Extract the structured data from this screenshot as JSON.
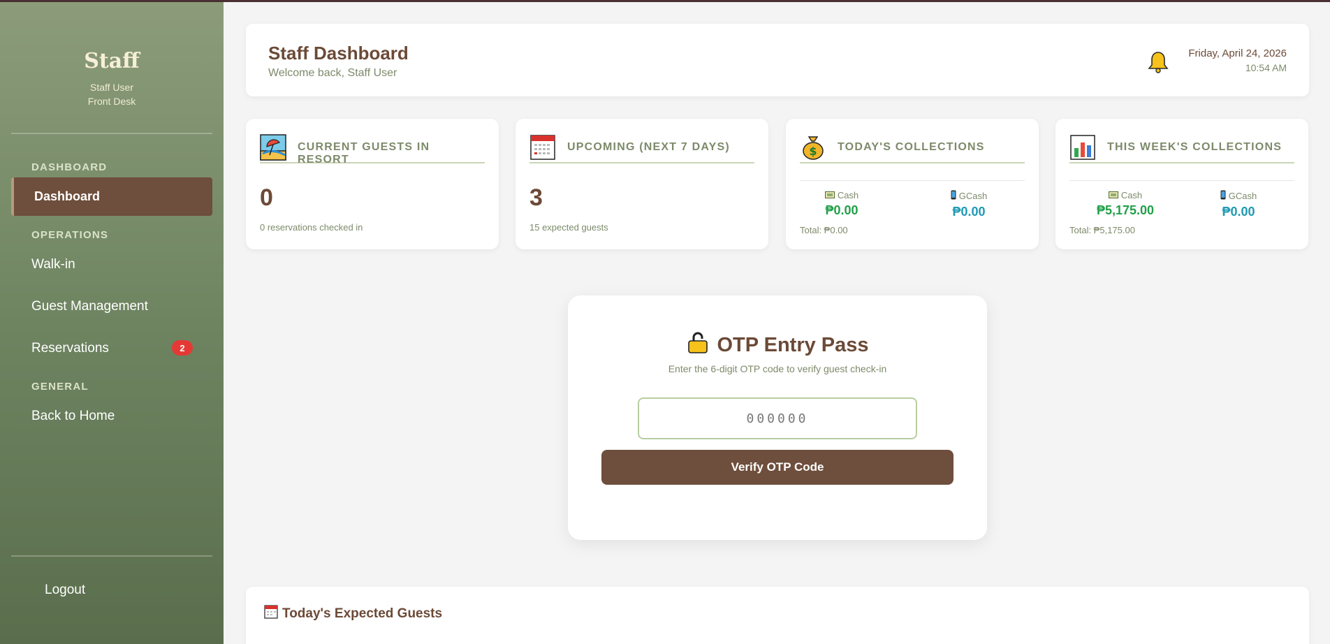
{
  "sidebar": {
    "brand_title": "Staff",
    "user_name": "Staff User",
    "user_role": "Front Desk",
    "sections": {
      "dashboard": "DASHBOARD",
      "operations": "OPERATIONS",
      "general": "GENERAL"
    },
    "items": {
      "dashboard": "Dashboard",
      "walkin": "Walk-in",
      "guest_management": "Guest Management",
      "reservations": "Reservations",
      "reservations_badge": "2",
      "back_home": "Back to Home",
      "logout": "Logout"
    }
  },
  "header": {
    "title": "Staff Dashboard",
    "subtitle": "Welcome back, Staff User",
    "date": "Friday, April 24, 2026",
    "time": "10:54 AM"
  },
  "cards": {
    "current_guests": {
      "label": "CURRENT GUESTS IN RESORT",
      "value": "0",
      "note": "0 reservations checked in"
    },
    "upcoming": {
      "label": "UPCOMING (NEXT 7 DAYS)",
      "value": "3",
      "note": "15 expected guests"
    },
    "today_collections": {
      "label": "TODAY'S COLLECTIONS",
      "cash_label": "Cash",
      "cash_value": "₱0.00",
      "gcash_label": "GCash",
      "gcash_value": "₱0.00",
      "total": "Total: ₱0.00"
    },
    "week_collections": {
      "label": "THIS WEEK'S COLLECTIONS",
      "cash_label": "Cash",
      "cash_value": "₱5,175.00",
      "gcash_label": "GCash",
      "gcash_value": "₱0.00",
      "total": "Total: ₱5,175.00"
    }
  },
  "otp": {
    "title": "OTP Entry Pass",
    "subtitle": "Enter the 6-digit OTP code to verify guest check-in",
    "placeholder": "000000",
    "button": "Verify OTP Code"
  },
  "expected_guests": {
    "title": "Today's Expected Guests"
  },
  "colors": {
    "primary_brown": "#6e4e3c",
    "sage_green": "#7d8a6a",
    "cash_green": "#22a04a",
    "gcash_blue": "#1f9ab4",
    "badge_red": "#e53935"
  }
}
